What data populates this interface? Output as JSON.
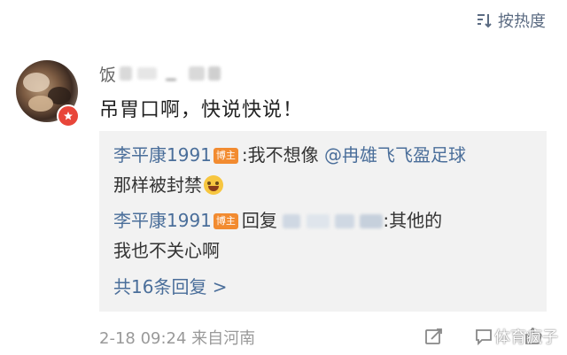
{
  "sort": {
    "label": "按热度"
  },
  "comment": {
    "username_visible": "饭",
    "text": "吊胃口啊，快说快说！"
  },
  "replies": [
    {
      "user": "李平康1991",
      "tag": "博主",
      "prefix": ":我不想像",
      "mention": "@冉雄飞飞盈足球",
      "line2": "那样被封禁",
      "emoji": "laughing-tears-emoji"
    },
    {
      "user": "李平康1991",
      "tag": "博主",
      "prefix": "回复",
      "tail": ":其他的",
      "line2": "我也不关心啊"
    }
  ],
  "more_replies": "共16条回复 >",
  "footer": {
    "time": "2-18 09:24 来自河南"
  },
  "watermark": "体育疯子",
  "colors": {
    "link": "#4a6e9a",
    "host_tag": "#f28b30",
    "badge": "#e8463a",
    "reply_bg": "#f2f2f2"
  }
}
